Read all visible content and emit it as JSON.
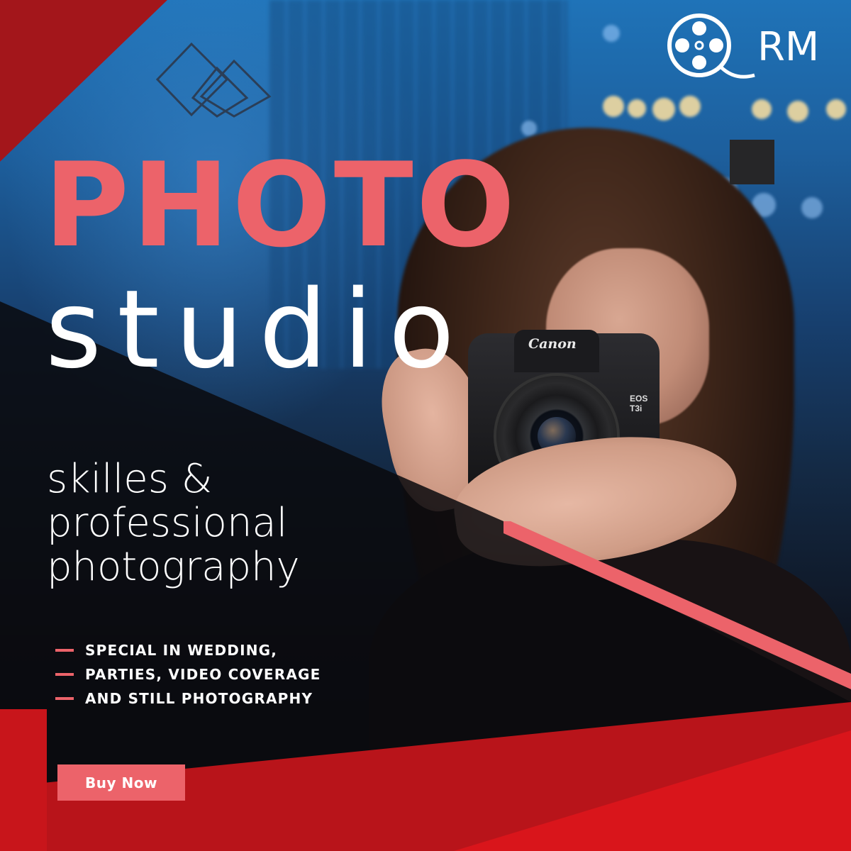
{
  "brand": {
    "logo_text": "RM"
  },
  "camera": {
    "brand": "Canon",
    "model_line1": "EOS",
    "model_line2": "T3i"
  },
  "headline": {
    "title": "PHOTO",
    "subtitle": "studio"
  },
  "tagline": {
    "lines": [
      "skilles &",
      "professional",
      "photography"
    ]
  },
  "features": [
    "SPECIAL IN WEDDING,",
    "PARTIES, VIDEO COVERAGE",
    "AND STILL PHOTOGRAPHY"
  ],
  "cta": {
    "label": "Buy Now"
  },
  "colors": {
    "accent_pink": "#ec636a",
    "deep_red": "#a3161b",
    "bright_red": "#d9151b",
    "dark_overlay": "#0a0a0e",
    "text_white": "#ffffff"
  },
  "icons": {
    "logo": "film-reel-icon",
    "decor_shape": "overlapping-diamonds-icon",
    "decor_square": "square-icon"
  }
}
